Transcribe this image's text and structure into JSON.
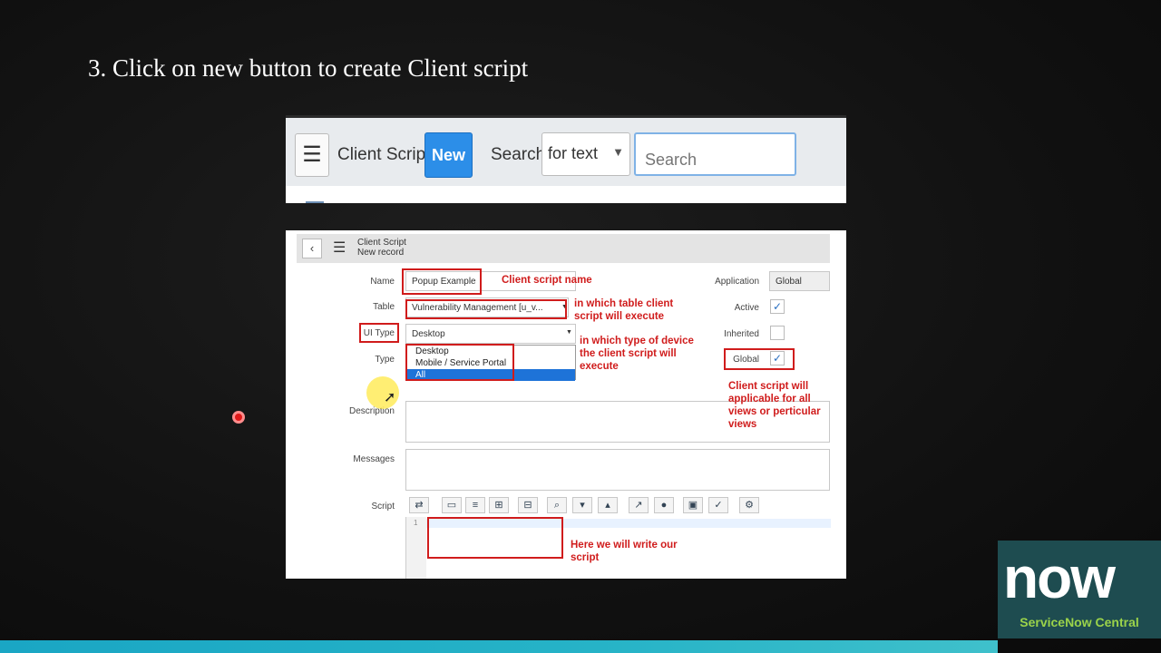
{
  "slide": {
    "title": "3. Click on new button to create Client script"
  },
  "list_view": {
    "menu_icon": "hamburger-icon",
    "title": "Client Scripts",
    "new_label": "New",
    "search_label": "Search",
    "search_field_option": "for text",
    "search_placeholder": "Search"
  },
  "form": {
    "header_title": "Client Script",
    "header_subtitle": "New record",
    "labels": {
      "name": "Name",
      "table": "Table",
      "ui_type": "UI Type",
      "type": "Type",
      "description": "Description",
      "messages": "Messages",
      "script": "Script",
      "application": "Application",
      "active": "Active",
      "inherited": "Inherited",
      "global": "Global"
    },
    "values": {
      "name": "Popup Example",
      "table": "Vulnerability Management [u_v...",
      "ui_type": "Desktop",
      "application": "Global"
    },
    "ui_type_options": [
      "Desktop",
      "Mobile / Service Portal",
      "All"
    ],
    "checkboxes": {
      "active": true,
      "inherited": false,
      "global": true
    },
    "editor_line_number": "1"
  },
  "annotations": {
    "name": "Client script name",
    "table": "in which table client script will execute",
    "ui_type": "in which type of device the client script will execute",
    "global": "Client script will applicable for all views or perticular views",
    "script": "Here we will write our script"
  },
  "logo": {
    "wordmark": "now",
    "subtitle": "ServiceNow Central",
    "accent": "#9bd34a"
  }
}
